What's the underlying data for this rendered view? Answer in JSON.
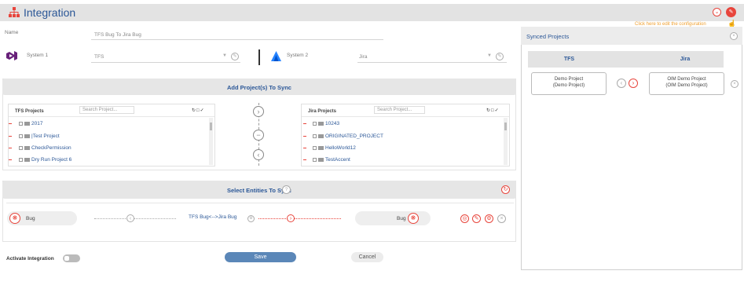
{
  "header": {
    "title": "Integration",
    "edit_hint": "Click here to edit the configuration"
  },
  "form": {
    "name_label": "Name",
    "name_value": "TFS Bug To Jira Bug",
    "system1_label": "System 1",
    "system1_value": "TFS",
    "system2_label": "System 2",
    "system2_value": "Jira"
  },
  "add_projects": {
    "title": "Add Project(s) To Sync",
    "tfs": {
      "header": "TFS Projects",
      "search_placeholder": "Search Project...",
      "items": [
        "2017",
        "|Test Project",
        "CheckPermission",
        "Dry Run Project 6"
      ]
    },
    "jira": {
      "header": "Jira Projects",
      "search_placeholder": "Search Project...",
      "items": [
        "10243",
        "ORIGINATED_PROJECT",
        "HelloWorld12",
        "TestAccent"
      ]
    }
  },
  "entities": {
    "title": "Select Entities To Sync",
    "left_entity": "Bug",
    "mapping": "TFS Bug<-->Jira Bug",
    "right_entity": "Bug"
  },
  "footer": {
    "activate_label": "Activate Integration",
    "save_label": "Save",
    "cancel_label": "Cancel"
  },
  "synced": {
    "title": "Synced Projects",
    "col_left": "TFS",
    "col_right": "Jira",
    "left_project": "Demo Project",
    "left_project_sub": "(Demo Project)",
    "right_project": "OIM Demo Project",
    "right_project_sub": "(OIM Demo Project)"
  },
  "colors": {
    "accent": "#e8453c",
    "brand": "#2b5797",
    "hint": "#f0a030"
  }
}
